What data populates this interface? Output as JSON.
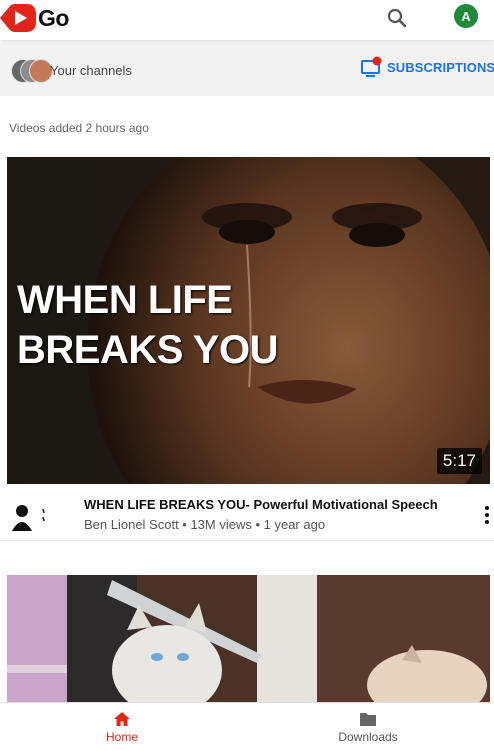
{
  "header": {
    "logo_text": "Go",
    "avatar_letter": "A",
    "search_icon": "search-icon"
  },
  "channels": {
    "your_channels_label": "Your channels",
    "subscriptions_label": "SUBSCRIPTIONS"
  },
  "feed": {
    "section_label": "Videos added 2 hours ago",
    "videos": [
      {
        "thumbnail_text_line1": "WHEN LIFE",
        "thumbnail_text_line2": "BREAKS YOU",
        "duration": "5:17",
        "title": "WHEN LIFE BREAKS YOU- Powerful Motivational Speech",
        "meta": "Ben Lionel Scott • 13M views • 1 year ago"
      }
    ]
  },
  "nav": {
    "home_label": "Home",
    "downloads_label": "Downloads"
  },
  "colors": {
    "accent_red": "#e0261b",
    "link_blue": "#1a73e8",
    "avatar_green": "#1f8a3a"
  }
}
